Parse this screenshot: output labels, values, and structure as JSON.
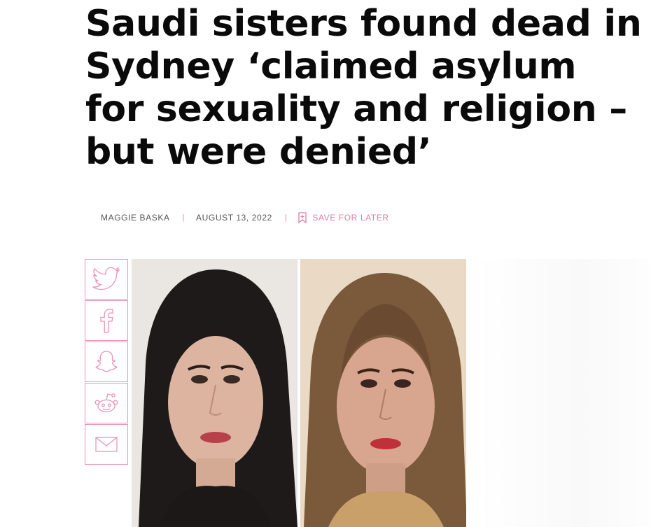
{
  "article": {
    "headline": "Saudi sisters found dead in Sydney ‘claimed asylum for sexuality and religion – but were denied’",
    "author": "MAGGIE BASKA",
    "date": "AUGUST 13, 2022",
    "save_label": "SAVE FOR LATER",
    "separator": "|"
  },
  "share_buttons": [
    {
      "icon": "twitter-icon"
    },
    {
      "icon": "facebook-icon"
    },
    {
      "icon": "snapchat-icon"
    },
    {
      "icon": "reddit-icon"
    },
    {
      "icon": "email-icon"
    }
  ],
  "colors": {
    "accent_pink": "#e995b6",
    "headline": "#0a0a0a",
    "byline": "#555555"
  }
}
